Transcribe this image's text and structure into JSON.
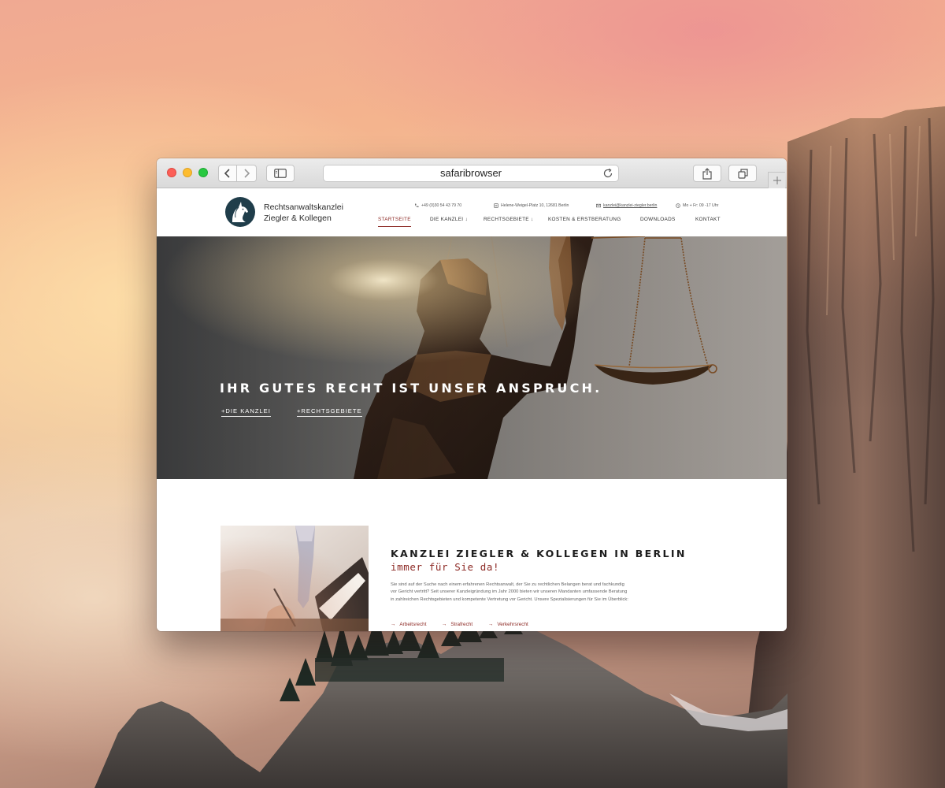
{
  "browser": {
    "url": "safaribrowser"
  },
  "site": {
    "brand_line1": "Rechtsanwaltskanzlei",
    "brand_line2": "Ziegler & Kollegen",
    "contact": {
      "phone": "+49 (0)30 54 43 79 70",
      "address": "Helene-Weigel-Platz 10, 12681 Berlin",
      "email": "kanzlei@kanzlei-ziegler.berlin",
      "hours": "Mo + Fr: 09 -17 Uhr"
    },
    "nav": [
      {
        "label": "STARTSEITE"
      },
      {
        "label": "DIE KANZLEI ↓"
      },
      {
        "label": "RECHTSGEBIETE ↓"
      },
      {
        "label": "KOSTEN & ERSTBERATUNG"
      },
      {
        "label": "DOWNLOADS"
      },
      {
        "label": "KONTAKT"
      }
    ]
  },
  "hero": {
    "headline": "IHR GUTES RECHT IST UNSER ANSPRUCH.",
    "link1": "+DIE KANZLEI",
    "link2": "+RECHTSGEBIETE"
  },
  "intro": {
    "title": "KANZLEI ZIEGLER & KOLLEGEN IN BERLIN",
    "subtitle": "immer für Sie da!",
    "body": "Sie sind auf der Suche nach einem erfahrenen Rechtsanwalt, der Sie zu rechtlichen Belangen berat und fachkundig vor Gericht vertritt? Seit unserer Kanzleigründung im Jahr 2000 bieten wir unseren Mandanten umfassende Beratung in zahlreichen Rechtsgebieten und kompetente Vertretung vor Gericht. Unsere Spezialisierungen für Sie im Überblick:",
    "areas": [
      {
        "label": "Arbeitsrecht"
      },
      {
        "label": "Strafrecht"
      },
      {
        "label": "Verkehrsrecht"
      }
    ]
  },
  "colors": {
    "accent": "#8d2a25",
    "logo": "#1f3d4a"
  }
}
